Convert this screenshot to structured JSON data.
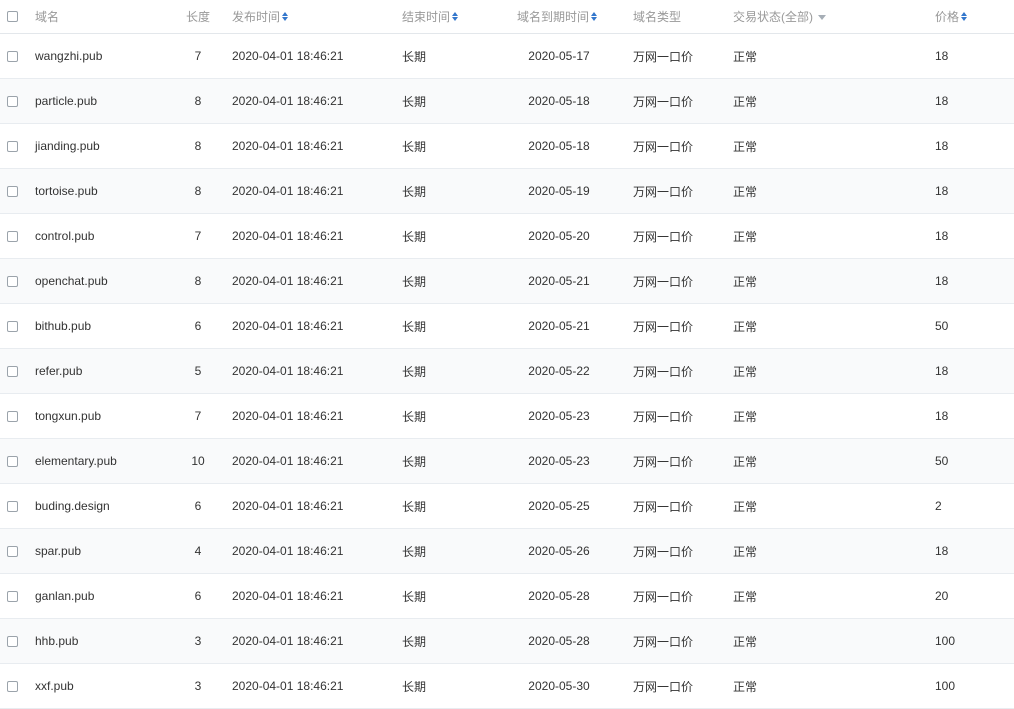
{
  "header": {
    "domain": "域名",
    "length": "长度",
    "publish_time": "发布时间",
    "end_time": "结束时间",
    "expire_time": "域名到期时间",
    "domain_type": "域名类型",
    "trade_status": "交易状态(全部)",
    "price": "价格"
  },
  "rows": [
    {
      "domain": "wangzhi.pub",
      "length": "7",
      "publish_time": "2020-04-01 18:46:21",
      "end_time": "长期",
      "expire_time": "2020-05-17",
      "domain_type": "万网一口价",
      "status": "正常",
      "price": "18"
    },
    {
      "domain": "particle.pub",
      "length": "8",
      "publish_time": "2020-04-01 18:46:21",
      "end_time": "长期",
      "expire_time": "2020-05-18",
      "domain_type": "万网一口价",
      "status": "正常",
      "price": "18"
    },
    {
      "domain": "jianding.pub",
      "length": "8",
      "publish_time": "2020-04-01 18:46:21",
      "end_time": "长期",
      "expire_time": "2020-05-18",
      "domain_type": "万网一口价",
      "status": "正常",
      "price": "18"
    },
    {
      "domain": "tortoise.pub",
      "length": "8",
      "publish_time": "2020-04-01 18:46:21",
      "end_time": "长期",
      "expire_time": "2020-05-19",
      "domain_type": "万网一口价",
      "status": "正常",
      "price": "18"
    },
    {
      "domain": "control.pub",
      "length": "7",
      "publish_time": "2020-04-01 18:46:21",
      "end_time": "长期",
      "expire_time": "2020-05-20",
      "domain_type": "万网一口价",
      "status": "正常",
      "price": "18"
    },
    {
      "domain": "openchat.pub",
      "length": "8",
      "publish_time": "2020-04-01 18:46:21",
      "end_time": "长期",
      "expire_time": "2020-05-21",
      "domain_type": "万网一口价",
      "status": "正常",
      "price": "18"
    },
    {
      "domain": "bithub.pub",
      "length": "6",
      "publish_time": "2020-04-01 18:46:21",
      "end_time": "长期",
      "expire_time": "2020-05-21",
      "domain_type": "万网一口价",
      "status": "正常",
      "price": "50"
    },
    {
      "domain": "refer.pub",
      "length": "5",
      "publish_time": "2020-04-01 18:46:21",
      "end_time": "长期",
      "expire_time": "2020-05-22",
      "domain_type": "万网一口价",
      "status": "正常",
      "price": "18"
    },
    {
      "domain": "tongxun.pub",
      "length": "7",
      "publish_time": "2020-04-01 18:46:21",
      "end_time": "长期",
      "expire_time": "2020-05-23",
      "domain_type": "万网一口价",
      "status": "正常",
      "price": "18"
    },
    {
      "domain": "elementary.pub",
      "length": "10",
      "publish_time": "2020-04-01 18:46:21",
      "end_time": "长期",
      "expire_time": "2020-05-23",
      "domain_type": "万网一口价",
      "status": "正常",
      "price": "50"
    },
    {
      "domain": "buding.design",
      "length": "6",
      "publish_time": "2020-04-01 18:46:21",
      "end_time": "长期",
      "expire_time": "2020-05-25",
      "domain_type": "万网一口价",
      "status": "正常",
      "price": "2"
    },
    {
      "domain": "spar.pub",
      "length": "4",
      "publish_time": "2020-04-01 18:46:21",
      "end_time": "长期",
      "expire_time": "2020-05-26",
      "domain_type": "万网一口价",
      "status": "正常",
      "price": "18"
    },
    {
      "domain": "ganlan.pub",
      "length": "6",
      "publish_time": "2020-04-01 18:46:21",
      "end_time": "长期",
      "expire_time": "2020-05-28",
      "domain_type": "万网一口价",
      "status": "正常",
      "price": "20"
    },
    {
      "domain": "hhb.pub",
      "length": "3",
      "publish_time": "2020-04-01 18:46:21",
      "end_time": "长期",
      "expire_time": "2020-05-28",
      "domain_type": "万网一口价",
      "status": "正常",
      "price": "100"
    },
    {
      "domain": "xxf.pub",
      "length": "3",
      "publish_time": "2020-04-01 18:46:21",
      "end_time": "长期",
      "expire_time": "2020-05-30",
      "domain_type": "万网一口价",
      "status": "正常",
      "price": "100"
    }
  ]
}
